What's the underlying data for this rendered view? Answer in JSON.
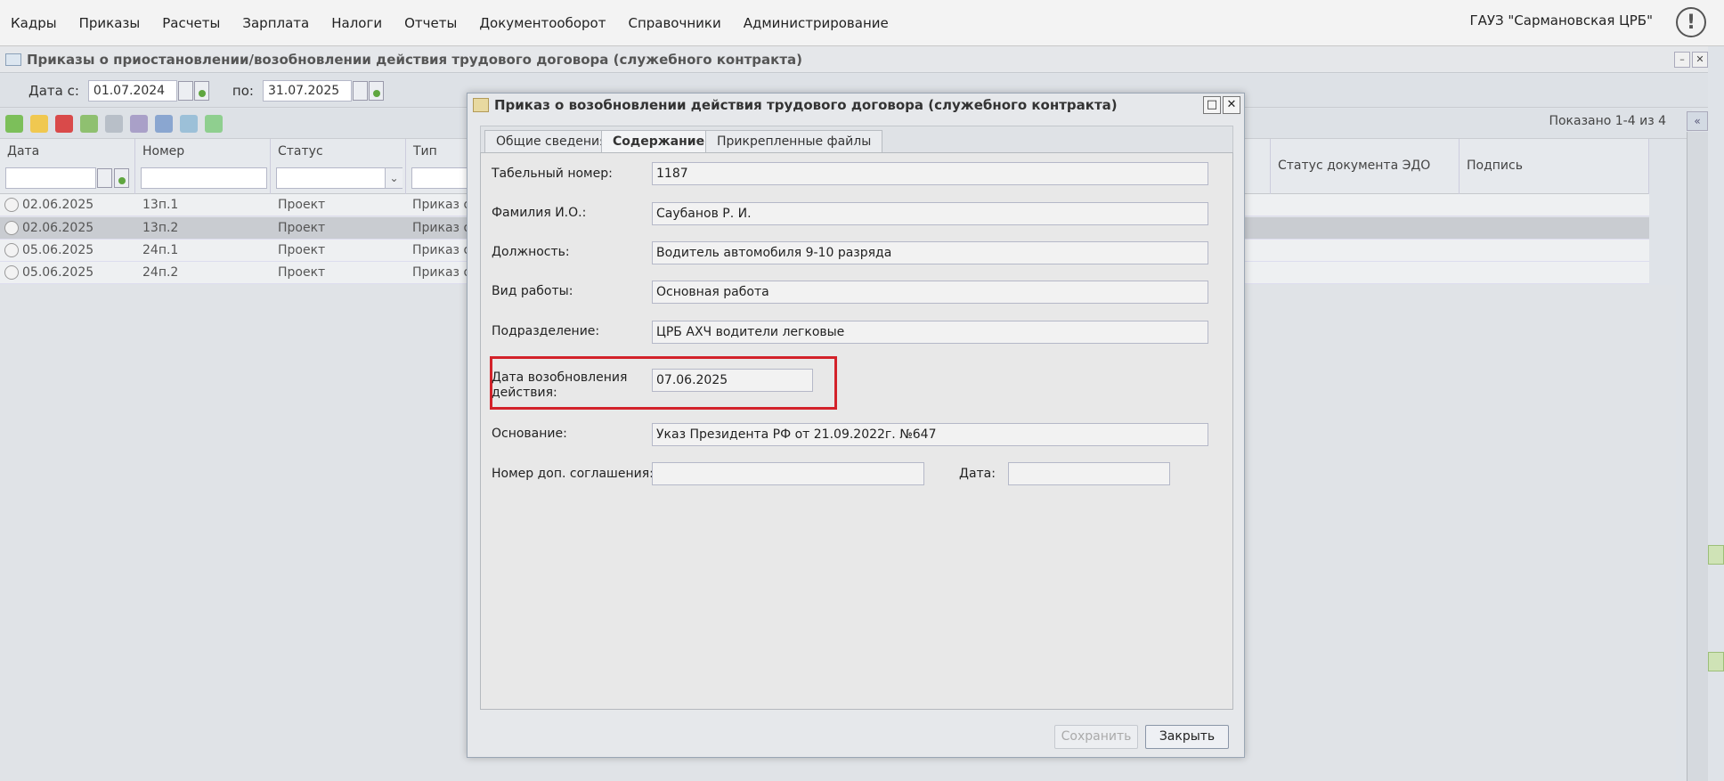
{
  "menu": {
    "items": [
      "Кадры",
      "Приказы",
      "Расчеты",
      "Зарплата",
      "Налоги",
      "Отчеты",
      "Документооборот",
      "Справочники",
      "Администрирование"
    ],
    "org": "ГАУЗ \"Сармановская ЦРБ\"",
    "alert_glyph": "!"
  },
  "main_window": {
    "title": "Приказы о приостановлении/возобновлении действия трудового договора (служебного контракта)",
    "date_from_label": "Дата с:",
    "date_from": "01.07.2024",
    "date_to_label": "по:",
    "date_to": "31.07.2025",
    "shown": "Показано 1-4 из 4"
  },
  "grid": {
    "columns": [
      "Дата",
      "Номер",
      "Статус",
      "Тип",
      "Статус документа ЭДО",
      "Подпись"
    ],
    "rows": [
      {
        "date": "02.06.2025",
        "number": "13п.1",
        "status": "Проект",
        "type": "Приказ о"
      },
      {
        "date": "02.06.2025",
        "number": "13п.2",
        "status": "Проект",
        "type": "Приказ о"
      },
      {
        "date": "05.06.2025",
        "number": "24п.1",
        "status": "Проект",
        "type": "Приказ о"
      },
      {
        "date": "05.06.2025",
        "number": "24п.2",
        "status": "Проект",
        "type": "Приказ о"
      }
    ]
  },
  "dialog": {
    "title": "Приказ о возобновлении действия трудового договора (служебного контракта)",
    "tabs": [
      "Общие сведения",
      "Содержание",
      "Прикрепленные файлы"
    ],
    "active_tab": "Содержание",
    "fields": {
      "tab_number_label": "Табельный номер:",
      "tab_number": "1187",
      "fio_label": "Фамилия И.О.:",
      "fio": "Саубанов Р. И.",
      "position_label": "Должность:",
      "position": "Водитель автомобиля 9-10 разряда",
      "work_type_label": "Вид работы:",
      "work_type": "Основная работа",
      "department_label": "Подразделение:",
      "department": "ЦРБ АХЧ водители легковые",
      "resume_date_label_1": "Дата возобновления",
      "resume_date_label_2": "действия:",
      "resume_date": "07.06.2025",
      "basis_label": "Основание:",
      "basis": "Указ Президента РФ от  21.09.2022г. №647",
      "agreement_label": "Номер доп. соглашения:",
      "agreement_number": "",
      "date_label": "Дата:",
      "agreement_date": ""
    },
    "buttons": {
      "save": "Сохранить",
      "close": "Закрыть"
    }
  },
  "colors": {
    "highlight": "#d3222a"
  }
}
